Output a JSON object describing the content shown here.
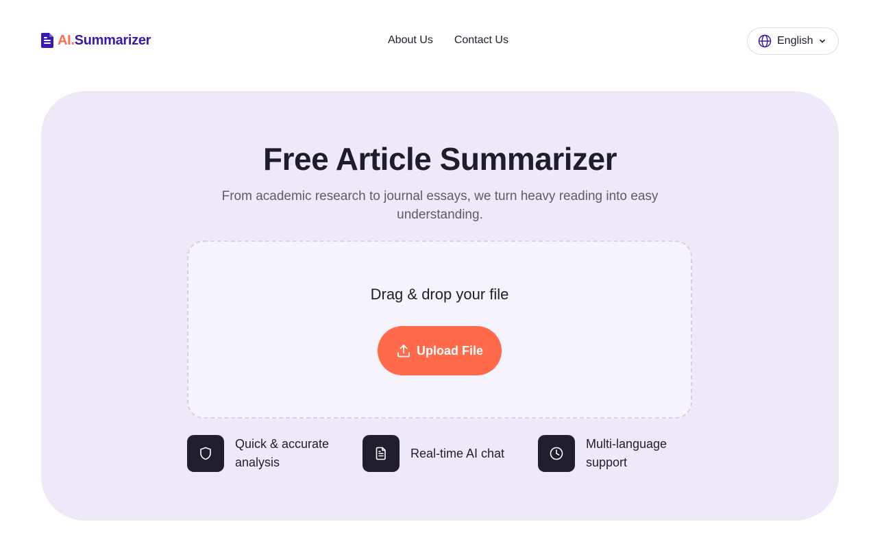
{
  "brand": {
    "prefix": "AI.",
    "name": "Summarizer",
    "accent": "#ff6b4a",
    "primary": "#3a1aa8",
    "icon": "document-icon"
  },
  "nav": {
    "items": [
      {
        "label": "About Us"
      },
      {
        "label": "Contact Us"
      }
    ]
  },
  "language": {
    "selected": "English",
    "icon": "globe-icon"
  },
  "hero": {
    "title": "Free Article Summarizer",
    "subtitle": "From academic research to journal essays, we turn heavy reading into easy understanding.",
    "dropzone": {
      "prompt": "Drag & drop your file",
      "upload_label": "Upload File"
    }
  },
  "features": [
    {
      "label": "Quick & accurate analysis",
      "icon": "shield-icon"
    },
    {
      "label": "Real-time AI chat",
      "icon": "document-icon"
    },
    {
      "label": "Multi-language support",
      "icon": "clock-icon"
    }
  ],
  "colors": {
    "hero_bg": "#efe8f8",
    "button": "#ff6b4a",
    "feature_icon_bg": "#211f2d"
  }
}
